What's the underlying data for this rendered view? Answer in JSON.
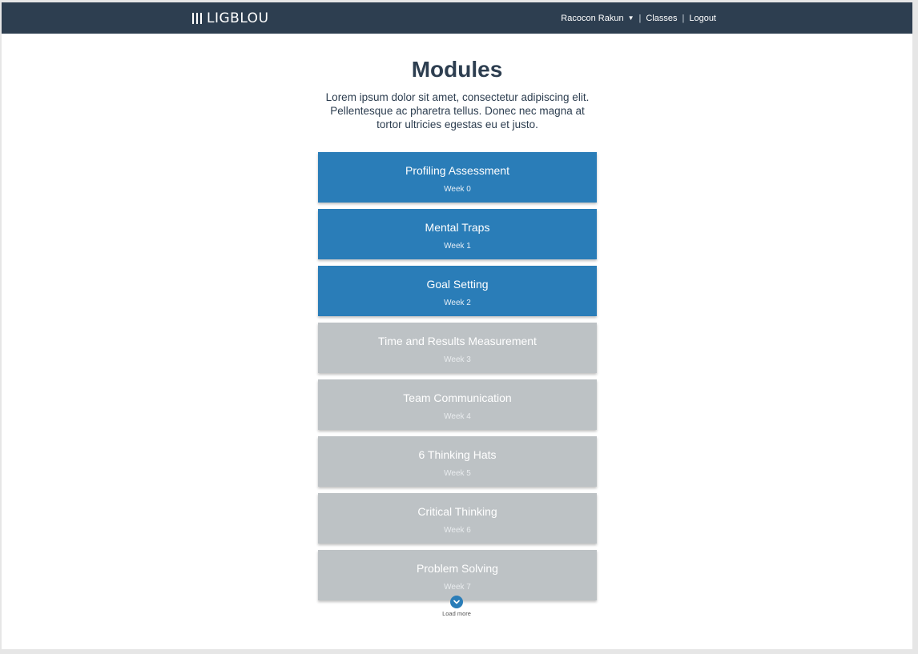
{
  "header": {
    "logo_text": "LIGBLOU",
    "user_name": "Racocon Rakun",
    "separator": "|",
    "classes_label": "Classes",
    "logout_label": "Logout"
  },
  "page": {
    "title": "Modules",
    "intro": "Lorem ipsum dolor sit amet, consectetur adipiscing elit. Pellentesque ac pharetra tellus. Donec nec magna at tortor ultricies egestas eu et justo."
  },
  "modules": [
    {
      "title": "Profiling Assessment",
      "week": "Week 0",
      "state": "active"
    },
    {
      "title": "Mental Traps",
      "week": "Week 1",
      "state": "active"
    },
    {
      "title": "Goal Setting",
      "week": "Week 2",
      "state": "active"
    },
    {
      "title": "Time and Results Measurement",
      "week": "Week 3",
      "state": "locked"
    },
    {
      "title": "Team Communication",
      "week": "Week 4",
      "state": "locked"
    },
    {
      "title": "6 Thinking Hats",
      "week": "Week 5",
      "state": "locked"
    },
    {
      "title": "Critical Thinking",
      "week": "Week 6",
      "state": "locked"
    },
    {
      "title": "Problem Solving",
      "week": "Week 7",
      "state": "locked"
    }
  ],
  "load_more": {
    "label": "Load more",
    "icon": "chevron-down-icon"
  },
  "colors": {
    "header_bg": "#2d3e50",
    "active_module": "#2a7db8",
    "locked_module": "#bdc2c5",
    "heading_text": "#2d3e50"
  }
}
